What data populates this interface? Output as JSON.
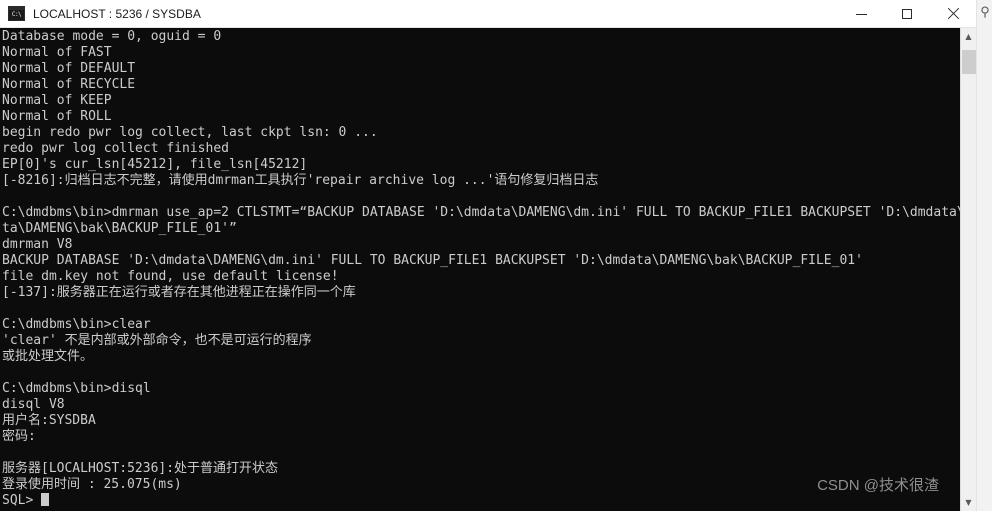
{
  "window": {
    "title": "LOCALHOST : 5236 / SYSDBA",
    "icon": "console-icon",
    "icon_text": "C:\\",
    "controls": {
      "minimize": "—",
      "maximize": "□",
      "close": "✕"
    }
  },
  "desktop": {
    "magnifier": "⚲"
  },
  "scrollbar": {
    "arrow_up": "▲",
    "arrow_down": "▼"
  },
  "watermark": {
    "text": "CSDN @技术很渣"
  },
  "colors": {
    "console_background": "#0c0c0c",
    "console_foreground": "#cccccc",
    "titlebar_background": "#ffffff",
    "titlebar_foreground": "#1b1b1b",
    "scrollbar_track": "#f0f0f0",
    "scrollbar_thumb": "#cdcdcd",
    "watermark": "#8f8f8f"
  },
  "console": {
    "prompt": "C:\\dmdbms\\bin>",
    "sql_prompt": "SQL>",
    "lines": [
      "Database mode = 0, oguid = 0",
      "Normal of FAST",
      "Normal of DEFAULT",
      "Normal of RECYCLE",
      "Normal of KEEP",
      "Normal of ROLL",
      "begin redo pwr log collect, last ckpt lsn: 0 ...",
      "redo pwr log collect finished",
      "EP[0]'s cur_lsn[45212], file_lsn[45212]",
      "[-8216]:归档日志不完整，请使用dmrman工具执行'repair archive log ...'语句修复归档日志",
      "",
      "C:\\dmdbms\\bin>dmrman use_ap=2 CTLSTMT=“BACKUP DATABASE 'D:\\dmdata\\DAMENG\\dm.ini' FULL TO BACKUP_FILE1 BACKUPSET 'D:\\dmdata\\DAMENG\\bak\\BACKUP_FILE_01'”",
      "ta\\DAMENG\\bak\\BACKUP_FILE_01'”",
      "dmrman V8",
      "BACKUP DATABASE 'D:\\dmdata\\DAMENG\\dm.ini' FULL TO BACKUP_FILE1 BACKUPSET 'D:\\dmdata\\DAMENG\\bak\\BACKUP_FILE_01'",
      "file dm.key not found, use default license!",
      "[-137]:服务器正在运行或者存在其他进程正在操作同一个库",
      "",
      "C:\\dmdbms\\bin>clear",
      "'clear' 不是内部或外部命令，也不是可运行的程序",
      "或批处理文件。",
      "",
      "C:\\dmdbms\\bin>disql",
      "disql V8",
      "用户名:SYSDBA",
      "密码:",
      "",
      "服务器[LOCALHOST:5236]:处于普通打开状态",
      "登录使用时间 : 25.075(ms)",
      "SQL>"
    ]
  }
}
